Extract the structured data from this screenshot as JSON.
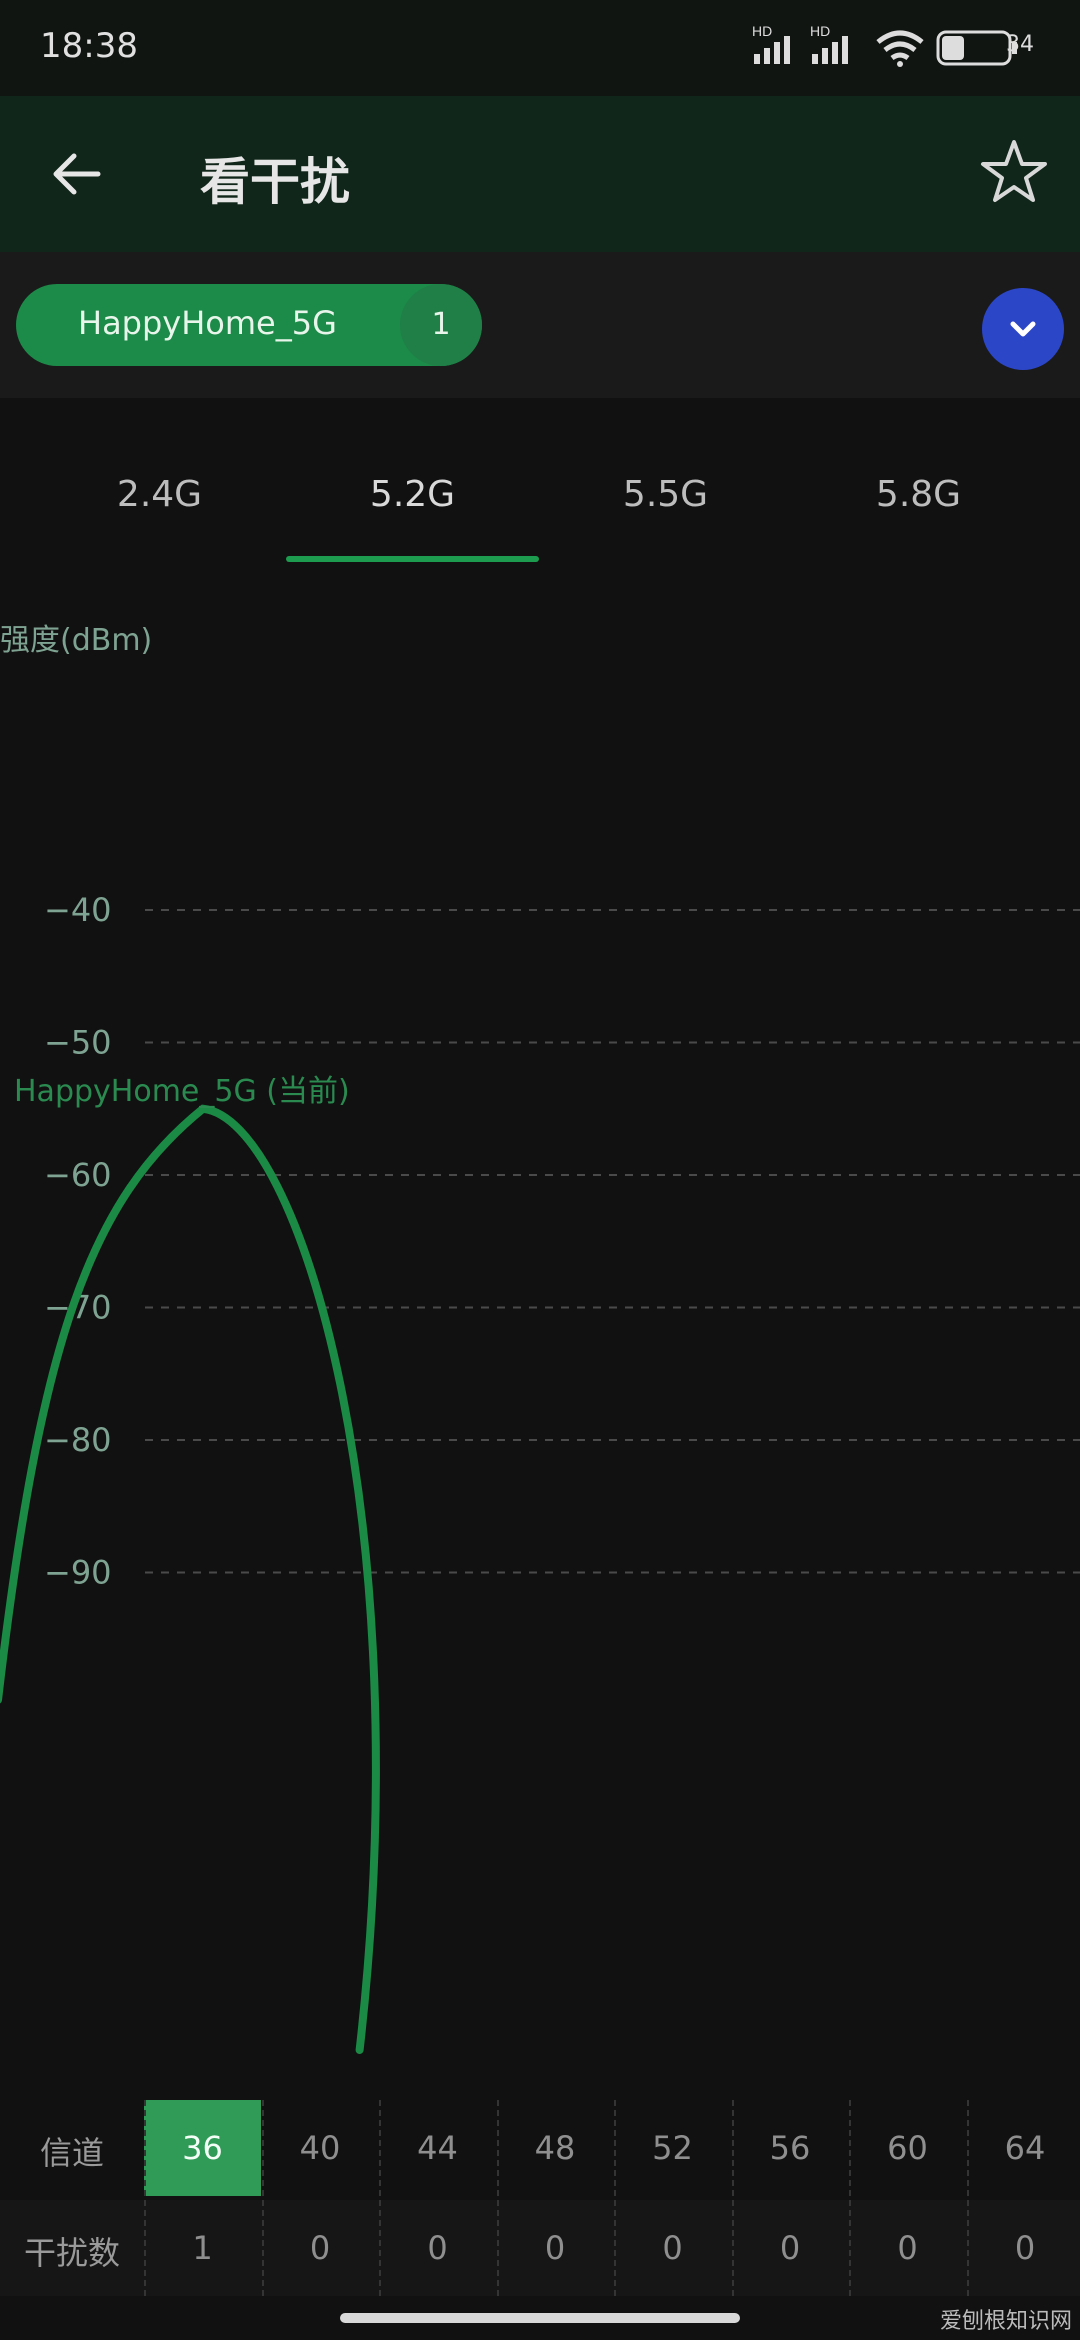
{
  "status": {
    "time": "18:38",
    "battery": "34",
    "hd1": "HD",
    "hd2": "HD"
  },
  "header": {
    "title": "看干扰"
  },
  "ssid": {
    "name": "HappyHome_5G",
    "count": "1"
  },
  "tabs": [
    "2.4G",
    "5.2G",
    "5.5G",
    "5.8G"
  ],
  "selected_tab": 1,
  "colors": {
    "accent": "#1d9c4f",
    "curve": "#1a8a45",
    "dropdown": "#2c46c8"
  },
  "chart_data": {
    "type": "line",
    "ylabel": "强度(dBm)",
    "yticks": [
      -40,
      -50,
      -60,
      -70,
      -80,
      -90
    ],
    "ylim": [
      -100,
      -30
    ],
    "series": [
      {
        "name": "HappyHome_5G (当前)",
        "channel": 36,
        "peak_dbm": -55
      }
    ],
    "grid": true
  },
  "table": {
    "row1_label": "信道",
    "row2_label": "干扰数",
    "channels": [
      "36",
      "40",
      "44",
      "48",
      "52",
      "56",
      "60",
      "64"
    ],
    "interference": [
      "1",
      "0",
      "0",
      "0",
      "0",
      "0",
      "0",
      "0"
    ],
    "selected_channel_index": 0
  },
  "icons": {
    "back": "arrow-left-icon",
    "star": "star-outline-icon",
    "dropdown": "chevron-down-icon",
    "signal": "cellular-signal-icon",
    "wifi": "wifi-icon",
    "battery": "battery-icon"
  },
  "watermark": "爱刨根知识网"
}
